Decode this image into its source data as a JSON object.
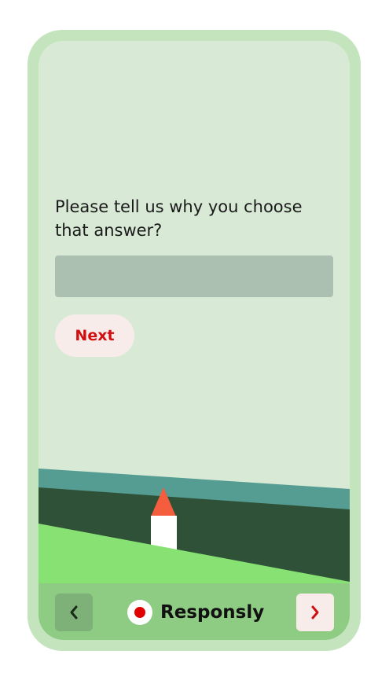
{
  "survey": {
    "question": "Please tell us why you choose that answer?",
    "answer_value": "",
    "answer_placeholder": "",
    "next_label": "Next"
  },
  "footer": {
    "prev_icon": "chevron-left-icon",
    "next_icon": "chevron-right-icon",
    "brand_name": "Responsly"
  },
  "colors": {
    "device_frame": "#c3e4bd",
    "screen_background": "#d8ead6",
    "input_background": "#abc0b0",
    "accent_red": "#d01010",
    "footer_background": "#8ecb83"
  }
}
